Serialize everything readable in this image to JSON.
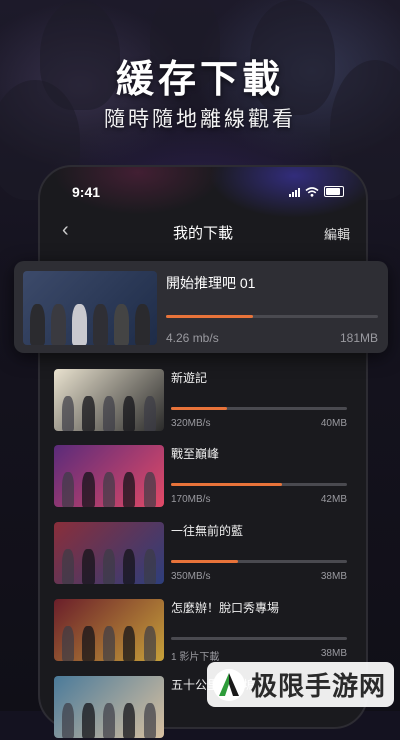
{
  "hero": {
    "title": "緩存下載",
    "subtitle": "隨時隨地離線觀看"
  },
  "status_bar": {
    "time": "9:41",
    "icons": [
      "signal-icon",
      "wifi-icon",
      "battery-icon"
    ]
  },
  "nav": {
    "back_icon": "chevron-left-icon",
    "title": "我的下載",
    "edit_label": "編輯"
  },
  "highlight": {
    "title": "開始推理吧 01",
    "speed": "4.26 mb/s",
    "size": "181MB",
    "progress": 0.41
  },
  "downloads": [
    {
      "title": "新遊記",
      "left": "320MB/s",
      "right": "40MB",
      "progress": 0.32,
      "thumb_colors": [
        "#e9e2cf",
        "#2a2a2a"
      ]
    },
    {
      "title": "戰至巔峰",
      "left": "170MB/s",
      "right": "42MB",
      "progress": 0.63,
      "thumb_colors": [
        "#5a2b7a",
        "#e24a67"
      ]
    },
    {
      "title": "一往無前的藍",
      "left": "350MB/s",
      "right": "38MB",
      "progress": 0.38,
      "thumb_colors": [
        "#8a2e3a",
        "#2d3e7c"
      ]
    },
    {
      "title": "怎麼辦！脫口秀專場",
      "left": "1 影片下載",
      "right": "38MB",
      "progress": 0,
      "thumb_colors": [
        "#6a1e2a",
        "#c7a13a"
      ]
    },
    {
      "title": "五十公里桃花塢",
      "left": "",
      "right": "",
      "progress": 0,
      "thumb_colors": [
        "#4a7a9a",
        "#d8c0a0"
      ]
    }
  ],
  "watermark": {
    "text": "极限手游网"
  },
  "colors": {
    "accent": "#e8733a",
    "background": "#141220",
    "phone": "#1a1a1e",
    "card": "#2e2e34"
  }
}
